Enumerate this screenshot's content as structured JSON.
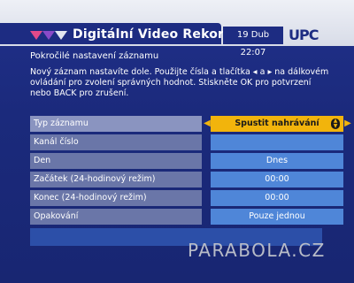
{
  "header": {
    "title": "Digitální Video Rekordér",
    "datetime": "19 Dub 22:07",
    "brand": "UPC",
    "logo_icon": "dvr-logo-icon"
  },
  "subtitle": "Pokročilé nastavení záznamu",
  "instructions": "Nový záznam nastavíte dole. Použijte čísla a tlačítka ◂ a ▸ na dálkovém ovládání pro zvolení správných hodnot. Stiskněte OK pro potvrzení nebo BACK pro zrušení.",
  "rows": [
    {
      "label": "Typ záznamu",
      "value": "Spustit nahrávání",
      "selected": true
    },
    {
      "label": "Kanál číslo",
      "value": ""
    },
    {
      "label": "Den",
      "value": "Dnes"
    },
    {
      "label": "Začátek (24-hodinový režim)",
      "value": "00:00"
    },
    {
      "label": "Konec (24-hodinový režim)",
      "value": "00:00"
    },
    {
      "label": "Opakování",
      "value": "Pouze jednou"
    }
  ],
  "watermark": "PARABOLA.CZ",
  "colors": {
    "background": "#1b2a7c",
    "row_label": "#6a76a8",
    "row_value": "#4f86d8",
    "selected": "#f2b40c"
  }
}
